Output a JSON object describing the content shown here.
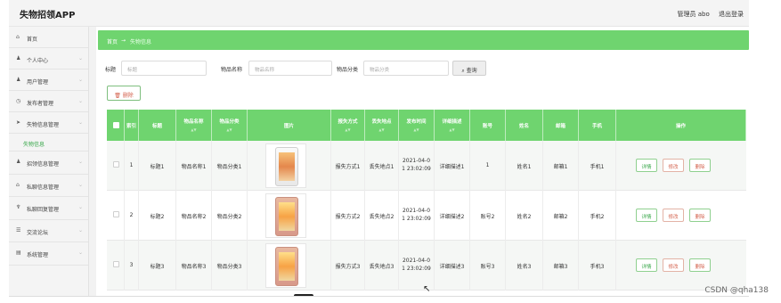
{
  "app": {
    "title": "失物招领APP",
    "admin_label": "管理员 abo",
    "logout_label": "退出登录"
  },
  "sidebar": {
    "items": [
      {
        "label": "首页",
        "icon": "home-icon",
        "glyph": "⌂",
        "chevron": false
      },
      {
        "label": "个人中心",
        "icon": "user-icon",
        "glyph": "♟",
        "chevron": true
      },
      {
        "label": "用户管理",
        "icon": "users-icon",
        "glyph": "♟",
        "chevron": true
      },
      {
        "label": "发布者管理",
        "icon": "clock-icon",
        "glyph": "◷",
        "chevron": true
      },
      {
        "label": "失物信息管理",
        "icon": "send-icon",
        "glyph": "➤",
        "chevron": true
      }
    ],
    "sub_item": "失物信息",
    "items2": [
      {
        "label": "招领信息管理",
        "icon": "person-icon",
        "glyph": "♟",
        "chevron": true
      },
      {
        "label": "私聊信息管理",
        "icon": "bank-icon",
        "glyph": "⌂",
        "chevron": true
      },
      {
        "label": "私聊回复管理",
        "icon": "pin-icon",
        "glyph": "♆",
        "chevron": true
      },
      {
        "label": "交流论坛",
        "icon": "forum-icon",
        "glyph": "☰",
        "chevron": true
      },
      {
        "label": "系统管理",
        "icon": "system-icon",
        "glyph": "▤",
        "chevron": true
      }
    ]
  },
  "breadcrumb": {
    "home": "首页",
    "arrow": "→",
    "current": "失物信息"
  },
  "search": {
    "title_label": "标题",
    "title_placeholder": "标题",
    "name_label": "物品名称",
    "name_placeholder": "物品名称",
    "category_label": "物品分类",
    "category_placeholder": "物品分类",
    "query_button": "查询"
  },
  "toolbar": {
    "delete_label": "删除"
  },
  "table": {
    "headers": {
      "index": "索引",
      "title": "标题",
      "item_name": "物品名称",
      "item_category": "物品分类",
      "image": "图片",
      "contact": "报失方式",
      "lost_place": "丢失地点",
      "publish_time": "发布时间",
      "detail_desc": "详细描述",
      "account": "账号",
      "name": "姓名",
      "email": "邮箱",
      "phone": "手机",
      "actions": "操作"
    },
    "rows": [
      {
        "index": "1",
        "title": "标题1",
        "item_name": "物品名称1",
        "item_category": "物品分类1",
        "phone_color": "white",
        "contact": "报失方式1",
        "lost_place": "丢失地点1",
        "time_line1": "2021-04-0",
        "time_line2": "1 23:02:09",
        "detail_desc": "详细描述1",
        "account": "1",
        "name": "姓名1",
        "email": "邮箱1",
        "mobile": "手机1"
      },
      {
        "index": "2",
        "title": "标题2",
        "item_name": "物品名称2",
        "item_category": "物品分类2",
        "phone_color": "pink",
        "contact": "报失方式2",
        "lost_place": "丢失地点2",
        "time_line1": "2021-04-0",
        "time_line2": "1 23:02:09",
        "detail_desc": "详细描述2",
        "account": "账号2",
        "name": "姓名2",
        "email": "邮箱2",
        "mobile": "手机2"
      },
      {
        "index": "3",
        "title": "标题3",
        "item_name": "物品名称3",
        "item_category": "物品分类3",
        "phone_color": "pink",
        "contact": "报失方式3",
        "lost_place": "丢失地点3",
        "time_line1": "2021-04-0",
        "time_line2": "1 23:02:09",
        "detail_desc": "详细描述3",
        "account": "账号3",
        "name": "姓名3",
        "email": "邮箱3",
        "mobile": "手机3"
      }
    ],
    "actions": {
      "detail": "详情",
      "edit": "修改",
      "delete": "删除"
    }
  },
  "watermark": "CSDN @qha138",
  "colors": {
    "accent": "#6fd46f",
    "danger": "#d4634f"
  }
}
